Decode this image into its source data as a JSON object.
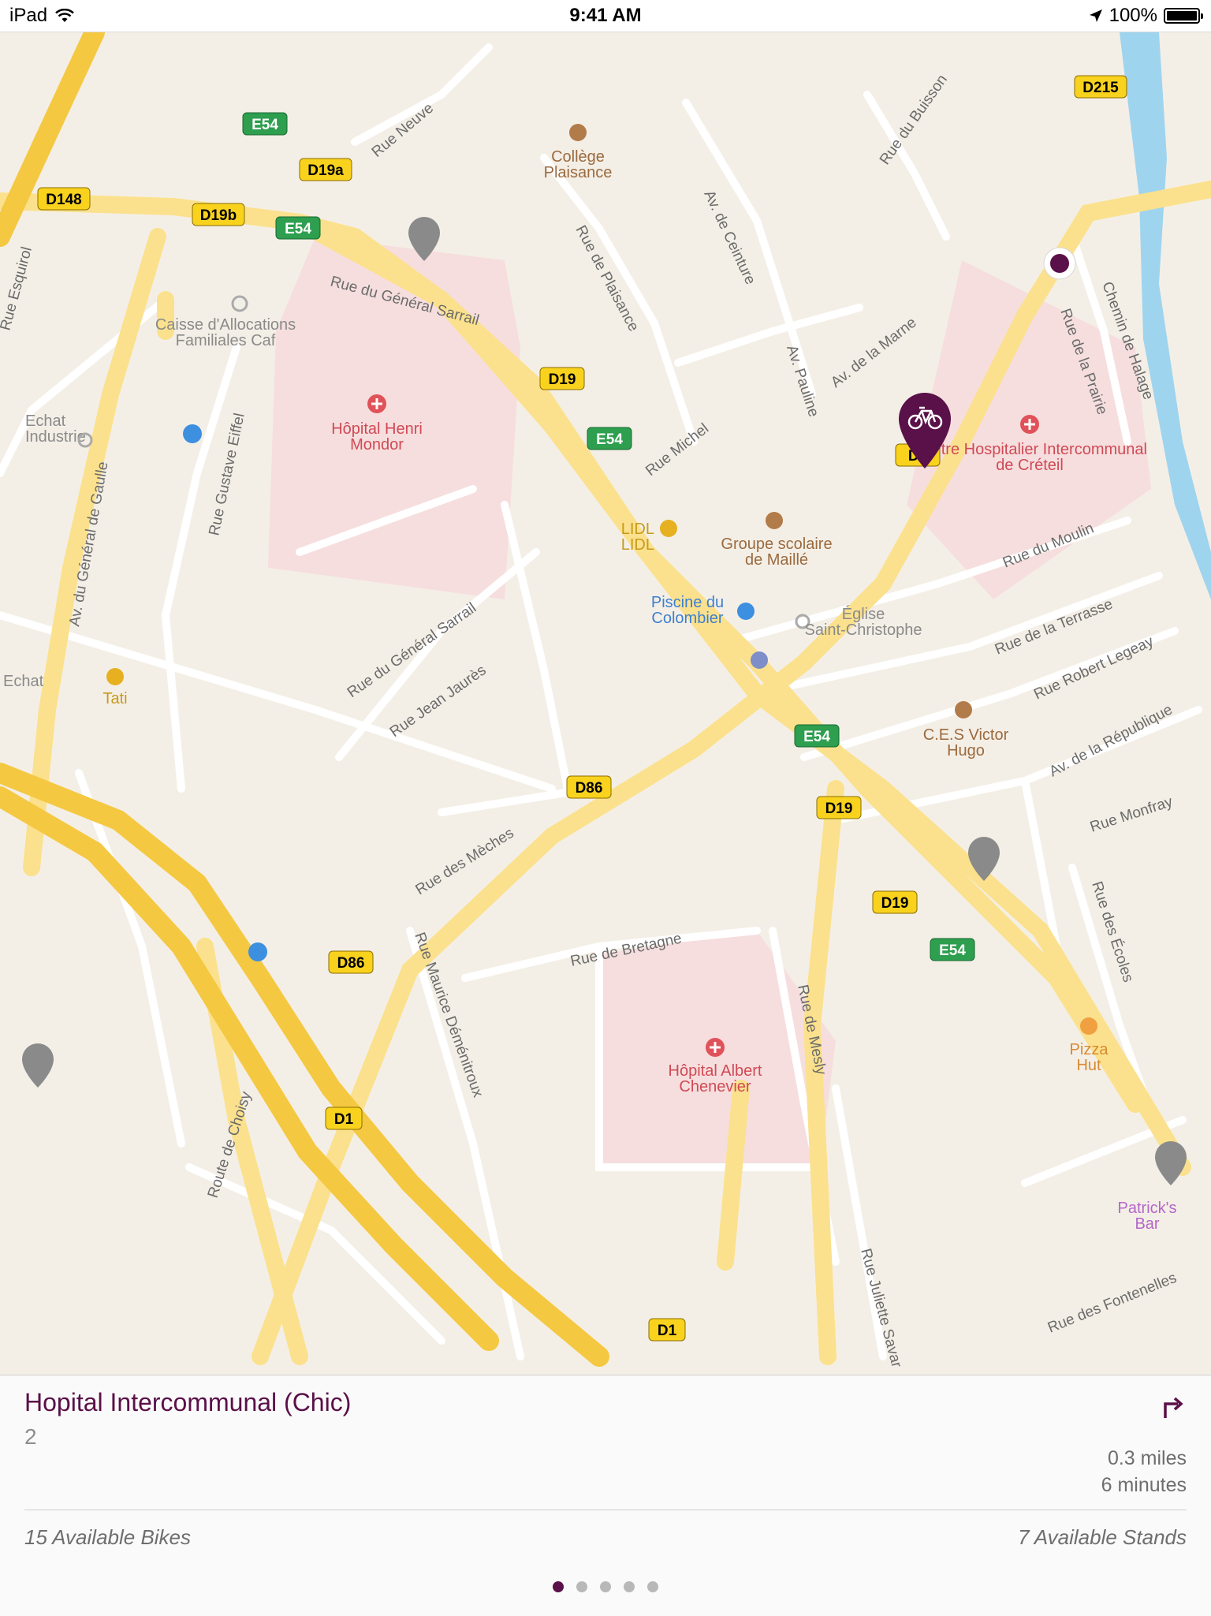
{
  "status_bar": {
    "device": "iPad",
    "time": "9:41 AM",
    "battery": "100%",
    "icons": [
      "wifi-icon",
      "location-arrow-icon",
      "battery-icon"
    ]
  },
  "map": {
    "street_labels": [
      "Rue Neuve",
      "Rue du Général Sarrail",
      "Rue du Général Sarrail",
      "Rue de Plaisance",
      "Av. de Ceinture",
      "Av. Pauline",
      "Av. de la Marne",
      "Rue du Buisson",
      "Rue de la Prairie",
      "Chemin de Halage",
      "Rue Michel",
      "Rue Jean Jaurès",
      "Rue Gustave Eiffel",
      "Av. du Général de Gaulle",
      "Rue Esquirol",
      "Rue du Moulin",
      "Rue de la Terrasse",
      "Rue Robert Legeay",
      "Av. de la République",
      "Rue Monfray",
      "Rue des Écoles",
      "Rue des Mèches",
      "Rue Maurice Déménitroux",
      "Rue de Bretagne",
      "Rue de Mesly",
      "Route de Choisy",
      "Rue Juliette Savar",
      "Rue des Fontenelles"
    ],
    "poi_labels": [
      {
        "name": "Collège Plaisance",
        "icon": "school-icon"
      },
      {
        "name": "Caisse d'Allocations Familiales Caf",
        "icon": "building-icon"
      },
      {
        "name": "Hôpital Henri Mondor",
        "icon": "hospital-icon"
      },
      {
        "name": "Echat Industrie",
        "icon": "building-icon"
      },
      {
        "name": "Centre Hospitalier Intercommunal de Créteil",
        "icon": "hospital-icon"
      },
      {
        "name": "LIDL LIDL",
        "icon": "shopping-icon"
      },
      {
        "name": "Groupe scolaire de Maillé",
        "icon": "school-icon"
      },
      {
        "name": "Piscine du Colombier",
        "icon": "swimming-icon"
      },
      {
        "name": "Église Saint-Christophe",
        "icon": "church-icon"
      },
      {
        "name": "C.E.S Victor Hugo",
        "icon": "school-icon"
      },
      {
        "name": "Tati",
        "icon": "shopping-icon"
      },
      {
        "name": "Echat",
        "icon": "building-icon"
      },
      {
        "name": "Hôpital Albert Chenevier",
        "icon": "hospital-icon"
      },
      {
        "name": "Pizza Hut",
        "icon": "restaurant-icon"
      },
      {
        "name": "Patrick's Bar",
        "icon": "bar-icon"
      }
    ],
    "road_shields": [
      "D215",
      "E54",
      "D19a",
      "D148",
      "D19b",
      "E54",
      "D19",
      "E54",
      "D1",
      "E54",
      "D86",
      "D19",
      "D19",
      "E54",
      "D86",
      "D1",
      "D1"
    ],
    "markers": [
      {
        "type": "selected-station",
        "icon": "bicycle-icon"
      },
      {
        "type": "station"
      },
      {
        "type": "station"
      },
      {
        "type": "station"
      },
      {
        "type": "station"
      },
      {
        "type": "user-location"
      }
    ],
    "colors": {
      "land": "#f4efe6",
      "street": "#ffffff",
      "major_road": "#fbe18d",
      "highway": "#f5c842",
      "hospital": "#f5dcdc",
      "water": "#9fd4ef",
      "accent": "#5a1048"
    }
  },
  "station_card": {
    "name": "Hopital Intercommunal (Chic)",
    "number": "2",
    "distance": "0.3 miles",
    "walk_time": "6 minutes",
    "available_bikes": "15 Available Bikes",
    "available_stands": "7 Available Stands",
    "page_count": 5,
    "current_page": 1
  }
}
